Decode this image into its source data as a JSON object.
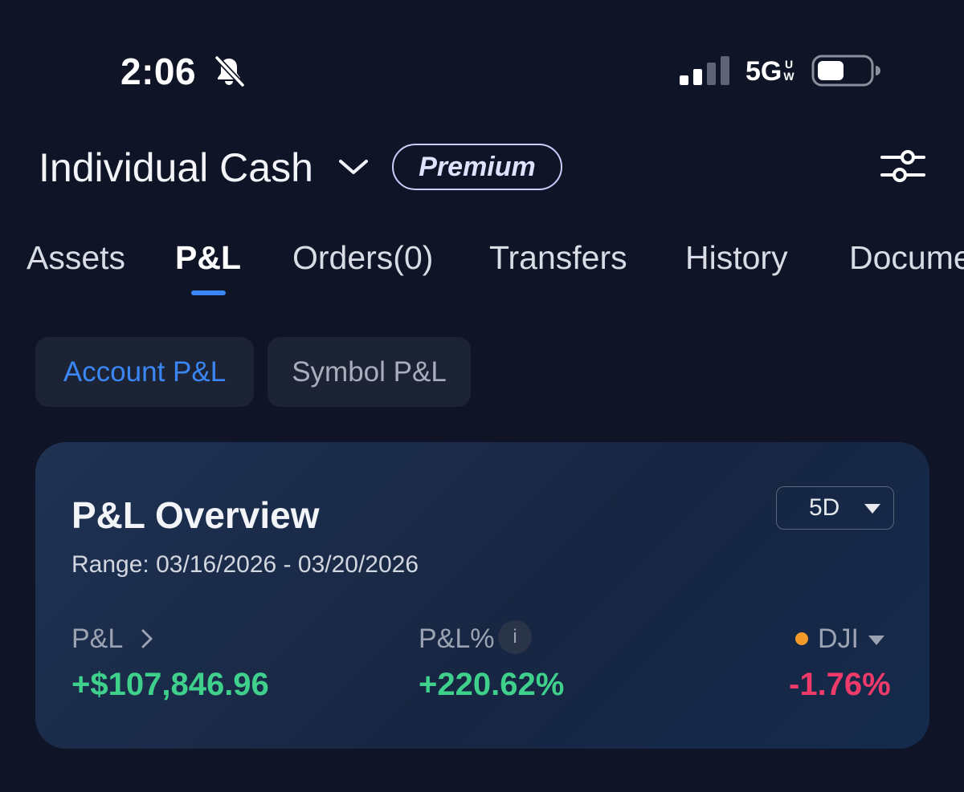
{
  "status_bar": {
    "time": "2:06",
    "network": "5G",
    "network_badge_top": "U",
    "network_badge_bottom": "W",
    "icons": [
      "bell-slash-icon",
      "signal-icon",
      "battery-icon"
    ]
  },
  "header": {
    "account_name": "Individual Cash",
    "badge": "Premium",
    "icons": [
      "chevron-down-icon",
      "settings-sliders-icon"
    ]
  },
  "tabs": [
    {
      "label": "Assets",
      "active": false
    },
    {
      "label": "P&L",
      "active": true
    },
    {
      "label": "Orders(0)",
      "active": false
    },
    {
      "label": "Transfers",
      "active": false
    },
    {
      "label": "History",
      "active": false
    },
    {
      "label": "Docume",
      "active": false
    }
  ],
  "segments": [
    {
      "label": "Account P&L",
      "active": true
    },
    {
      "label": "Symbol P&L",
      "active": false
    }
  ],
  "overview": {
    "title": "P&L Overview",
    "period": "5D",
    "range": "Range: 03/16/2026 - 03/20/2026",
    "metrics": {
      "pnl_label": "P&L",
      "pnl_value": "+$107,846.96",
      "pnl_pct_label": "P&L%",
      "pnl_pct_value": "+220.62%",
      "benchmark_label": "DJI",
      "benchmark_value": "-1.76%",
      "info_symbol": "i"
    }
  },
  "colors": {
    "background": "#0f1526",
    "accent": "#3b86f5",
    "positive": "#3fd18c",
    "negative": "#f03a6a",
    "benchmark_dot": "#f39a2a"
  }
}
